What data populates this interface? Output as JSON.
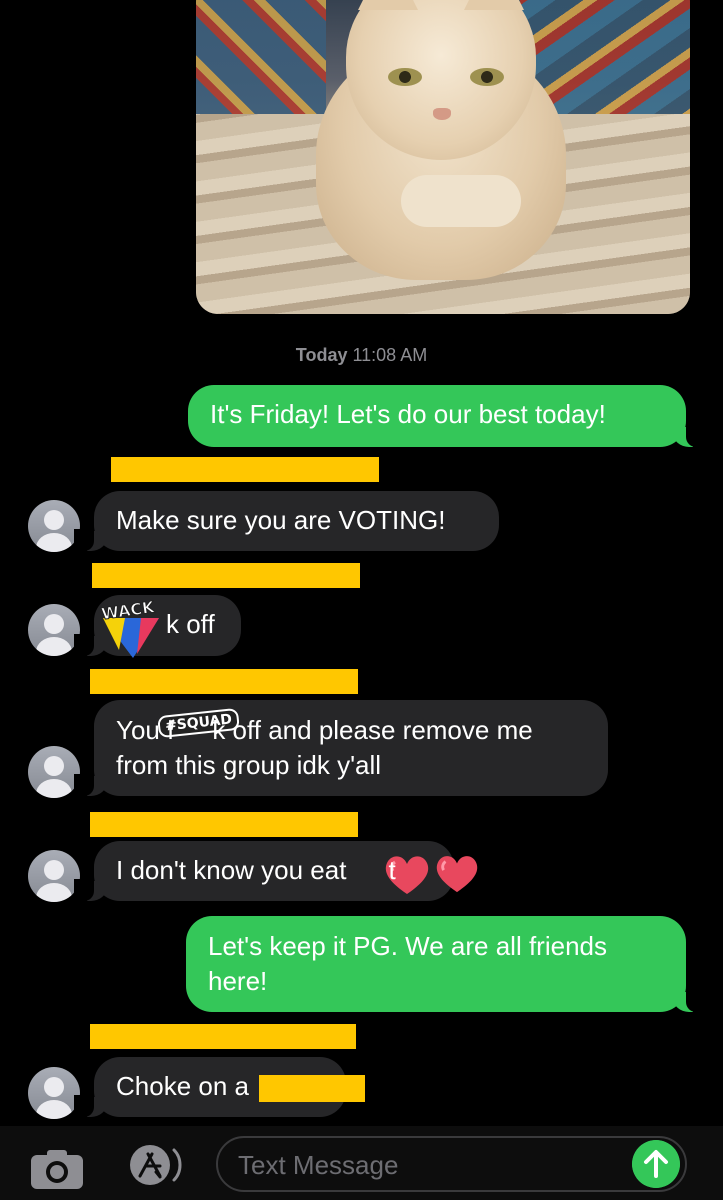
{
  "photo": {
    "description_icon": "cat-photo"
  },
  "timestamp": {
    "day": "Today",
    "time": "11:08 AM"
  },
  "messages": [
    {
      "text": "It's Friday! Let's do our best today!"
    },
    {
      "text": "Make sure you are VOTING!"
    },
    {
      "text": "k off"
    },
    {
      "text_a": "You f",
      "text_b": "k off and please remove me",
      "text_c": "from this group idk y'all"
    },
    {
      "text_a": "I don't know you eat",
      "text_b": "t"
    },
    {
      "text_line1": "Let's keep it PG. We are all friends",
      "text_line2": "here!"
    },
    {
      "text": "Choke on a"
    }
  ],
  "stickers": {
    "wack": "WACK",
    "squad": "#SQUAD"
  },
  "input": {
    "placeholder": "Text Message"
  },
  "colors": {
    "outgoing": "#34c759",
    "incoming": "#262628",
    "redaction": "#ffc700",
    "background": "#000000"
  },
  "icons": {
    "camera": "camera-icon",
    "appstore": "app-store-icon",
    "send": "send-arrow-icon"
  }
}
